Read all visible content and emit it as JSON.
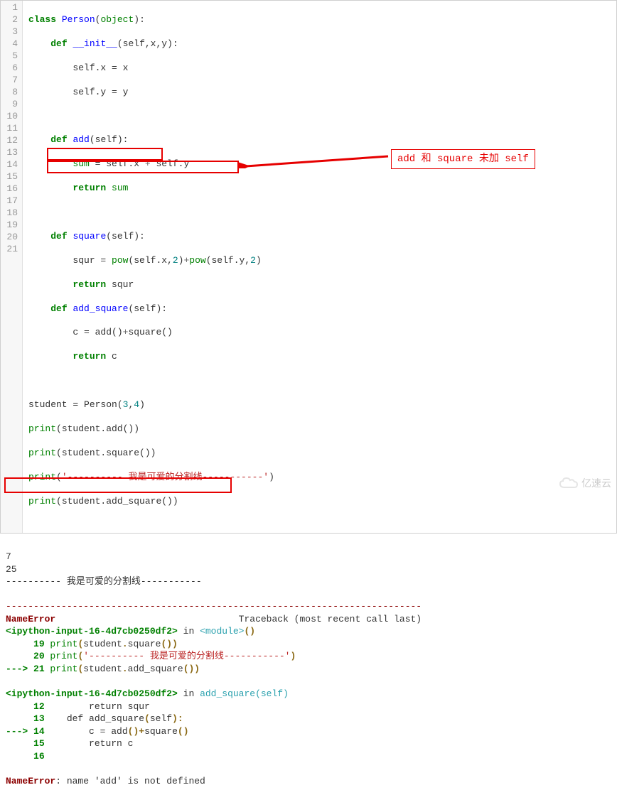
{
  "editor": {
    "lines": {
      "l01_class": "class",
      "l01_name": "Person",
      "l01_obj": "object",
      "l02_def": "def",
      "l02_name": "__init__",
      "l02_args": "(self,x,y):",
      "l03": "self.x = x",
      "l04": "self.y = y",
      "l06_def": "def",
      "l06_name": "add",
      "l06_args": "(self):",
      "l07_a": "sum",
      "l07_eq": " = self.x ",
      "l07_plus": "+",
      "l07_b": " self.y",
      "l08_ret": "return",
      "l08_val": " sum",
      "l10_def": "def",
      "l10_name": "square",
      "l10_args": "(self):",
      "l11_a": "squr = ",
      "l11_pow1": "pow",
      "l11_mid1": "(self.x,",
      "l11_two1": "2",
      "l11_close1": ")",
      "l11_plus": "+",
      "l11_pow2": "pow",
      "l11_mid2": "(self.y,",
      "l11_two2": "2",
      "l11_close2": ")",
      "l12_ret": "return",
      "l12_val": " squr",
      "l13_def": "def",
      "l13_name": "add_square",
      "l13_args": "(self):",
      "l14_a": "c = add()",
      "l14_plus": "+",
      "l14_b": "square()",
      "l15_ret": "return",
      "l15_val": " c",
      "l17_a": "student = Person(",
      "l17_n1": "3",
      "l17_c": ",",
      "l17_n2": "4",
      "l17_b": ")",
      "l18_p": "print",
      "l18_r": "(student.add())",
      "l19_p": "print",
      "l19_r": "(student.square())",
      "l20_p": "print",
      "l20_q1": "(",
      "l20_s": "'---------- 我是可爱的分割线-----------'",
      "l20_q2": ")",
      "l21_p": "print",
      "l21_r": "(student.add_square())"
    },
    "line_numbers": [
      "1",
      "2",
      "3",
      "4",
      "5",
      "6",
      "7",
      "8",
      "9",
      "10",
      "11",
      "12",
      "13",
      "14",
      "15",
      "16",
      "17",
      "18",
      "19",
      "20",
      "21"
    ]
  },
  "annotation": {
    "text": "add 和 square 未加 self"
  },
  "output": {
    "line1": "7",
    "line2": "25",
    "line3": "---------- 我是可爱的分割线-----------",
    "sep": "---------------------------------------------------------------------------",
    "err_name": "NameError",
    "traceback_hdr": "                                 Traceback (most recent call last)",
    "file1": "<ipython-input-16-4d7cb0250df2>",
    "in": " in ",
    "mod": "<module>",
    "ln19_no": "19",
    "ln19_text": " print",
    "ln19_rest_a": "student",
    "ln19_rest_b": "square",
    "ln20_no": "20",
    "ln20_text": " print",
    "ln20_str": "'---------- 我是可爱的分割线-----------'",
    "ln21_arrow": "---> ",
    "ln21_no": "21",
    "ln21_text": " print",
    "ln21_rest_a": "student",
    "ln21_rest_b": "add_square",
    "file2": "<ipython-input-16-4d7cb0250df2>",
    "func2": "add_square",
    "self2": "(self)",
    "ln12_no": "12",
    "ln12_text": "        return squr",
    "ln13_no": "13",
    "ln13_text": "    def add_square",
    "ln14_no": "14",
    "ln14_text": "        c = add",
    "ln14_plus": "+",
    "ln14_sq": "square",
    "ln15_no": "15",
    "ln15_text": "        return c",
    "ln16_no": "16",
    "final_err": "NameError",
    "final_msg": ": name 'add' is not defined"
  },
  "watermark": "亿速云"
}
